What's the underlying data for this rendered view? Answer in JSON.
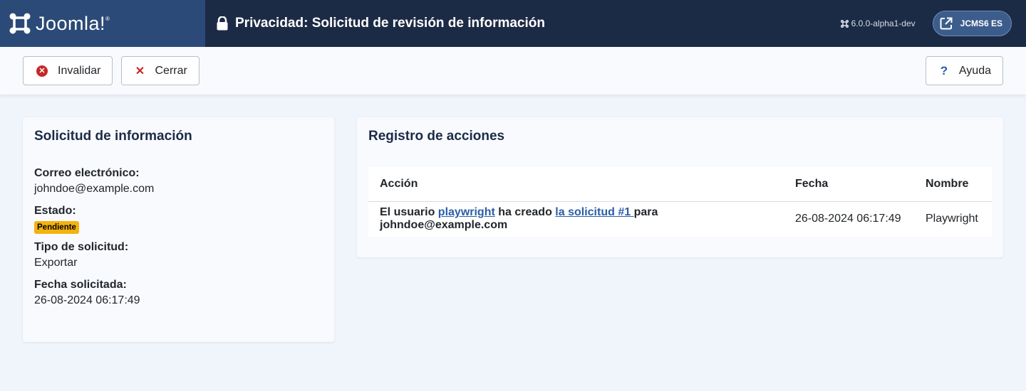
{
  "header": {
    "logo_text": "Joomla!",
    "logo_mark": "®",
    "title": "Privacidad: Solicitud de revisión de información",
    "version": "6.0.0-alpha1-dev",
    "site_label": "JCMS6 ES"
  },
  "toolbar": {
    "invalidate_label": "Invalidar",
    "close_label": "Cerrar",
    "help_label": "Ayuda"
  },
  "request": {
    "title": "Solicitud de información",
    "email_label": "Correo electrónico:",
    "email_value": "johndoe@example.com",
    "status_label": "Estado:",
    "status_value": "Pendiente",
    "type_label": "Tipo de solicitud:",
    "type_value": "Exportar",
    "date_label": "Fecha solicitada:",
    "date_value": "26-08-2024 06:17:49"
  },
  "log": {
    "title": "Registro de acciones",
    "columns": [
      "Acción",
      "Fecha",
      "Nombre"
    ],
    "rows": [
      {
        "action_prefix": "El usuario ",
        "user_link": "playwright",
        "action_mid": " ha creado ",
        "request_link": "la solicitud #1 ",
        "action_suffix": "para johndoe@example.com",
        "date": "26-08-2024 06:17:49",
        "name": "Playwright"
      }
    ]
  },
  "colors": {
    "header_bg": "#1c2b45",
    "logo_bg": "#2c4a77",
    "danger": "#c52827",
    "link": "#2a5ea8",
    "badge_warning": "#f3b30e"
  }
}
